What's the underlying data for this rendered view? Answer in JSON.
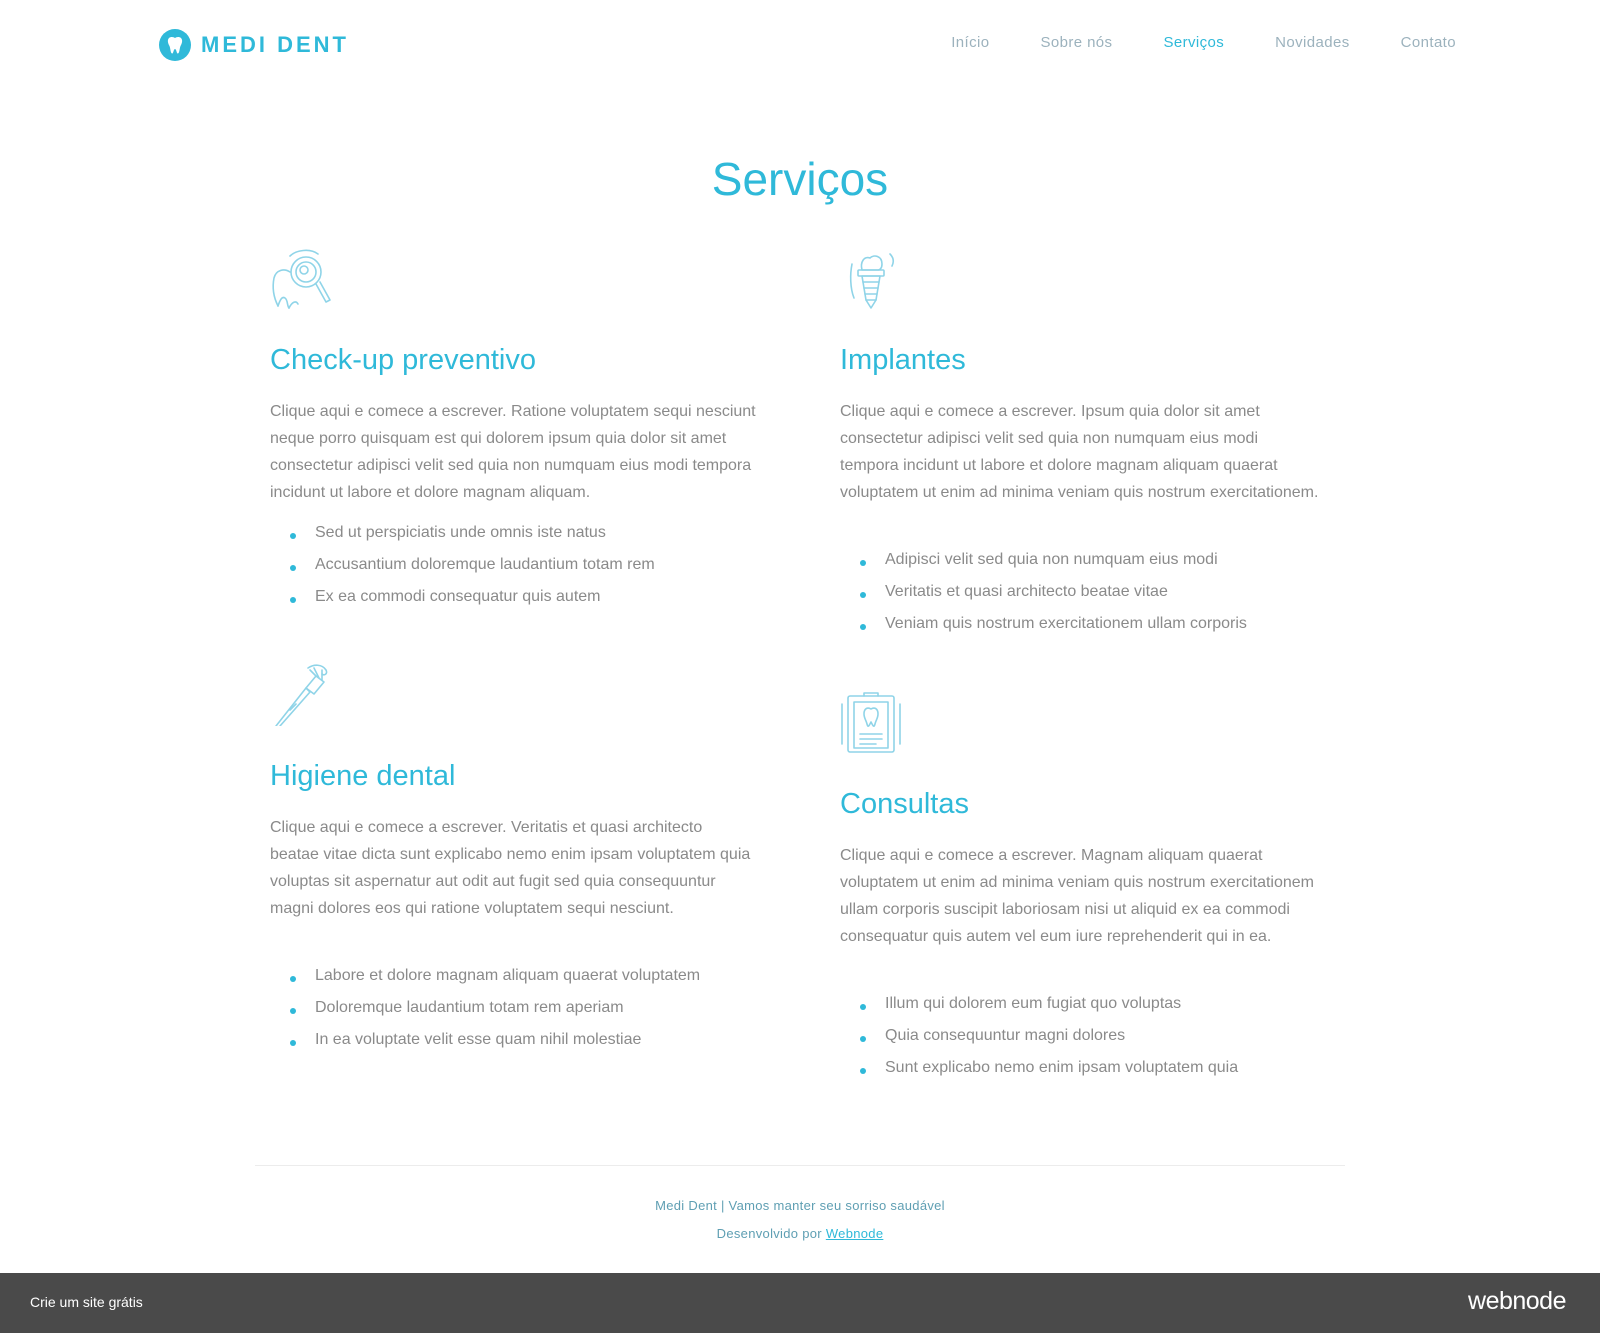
{
  "brand": {
    "name": "MEDI DENT",
    "color": "#2fb9d9",
    "icon": "tooth-icon"
  },
  "nav": {
    "items": [
      "Início",
      "Sobre nós",
      "Serviços",
      "Novidades",
      "Contato"
    ],
    "active": "Serviços"
  },
  "page": {
    "title": "Serviços"
  },
  "services": [
    {
      "icon": "magnifier-tooth-icon",
      "title": "Check-up preventivo",
      "text": "Clique aqui e comece a escrever. Ratione voluptatem sequi nesciunt neque porro quisquam est qui dolorem ipsum quia dolor sit amet consectetur adipisci velit sed quia non numquam eius modi tempora incidunt ut labore et dolore magnam aliquam.",
      "bullets": [
        "Sed ut perspiciatis unde omnis iste natus",
        "Accusantium doloremque laudantium totam rem",
        "Ex ea commodi consequatur quis autem"
      ]
    },
    {
      "icon": "dental-implant-icon",
      "title": "Implantes",
      "text": "Clique aqui e comece a escrever. Ipsum quia dolor sit amet consectetur adipisci velit sed quia non numquam eius modi tempora incidunt ut labore et dolore magnam aliquam quaerat voluptatem ut enim ad minima veniam quis nostrum exercitationem.",
      "bullets": [
        "Adipisci velit sed quia non numquam eius modi",
        "Veritatis et quasi architecto beatae vitae",
        "Veniam quis nostrum exercitationem ullam corporis"
      ]
    },
    {
      "icon": "toothbrush-icon",
      "title": "Higiene dental",
      "text": "Clique aqui e comece a escrever. Veritatis et quasi architecto beatae vitae dicta sunt explicabo nemo enim ipsam voluptatem quia voluptas sit aspernatur aut odit aut fugit sed quia consequuntur magni dolores eos qui ratione voluptatem sequi nesciunt.",
      "bullets": [
        "Labore et dolore magnam aliquam quaerat voluptatem",
        "Doloremque laudantium totam rem aperiam",
        "In ea voluptate velit esse quam nihil molestiae"
      ]
    },
    {
      "icon": "dental-chart-icon",
      "title": "Consultas",
      "text": "Clique aqui e comece a escrever. Magnam aliquam quaerat voluptatem ut enim ad minima veniam quis nostrum exercitationem ullam corporis suscipit laboriosam nisi ut aliquid ex ea commodi consequatur quis autem vel eum iure reprehenderit qui in ea.",
      "bullets": [
        "Illum qui dolorem eum fugiat quo voluptas",
        "Quia consequuntur magni dolores",
        "Sunt explicabo nemo enim ipsam voluptatem quia"
      ]
    }
  ],
  "footer": {
    "tagline": "Medi Dent | Vamos manter seu sorriso saudável",
    "developed_by": "Desenvolvido por",
    "developer_link": "Webnode"
  },
  "promo_bar": {
    "cta": "Crie um site grátis",
    "brand": "webnode",
    "background": "#4a4a4a"
  }
}
